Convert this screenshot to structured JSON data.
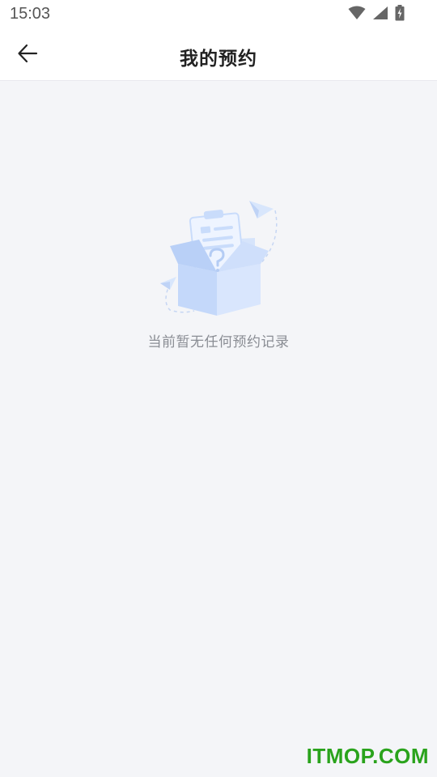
{
  "status_bar": {
    "time": "15:03",
    "icons": [
      "wifi-icon",
      "cellular-signal-icon",
      "battery-charging-icon"
    ]
  },
  "header": {
    "title": "我的预约",
    "back_icon": "arrow-left-icon"
  },
  "empty_state": {
    "illustration": "empty-box-with-clipboard-and-paper-planes",
    "message": "当前暂无任何预约记录"
  },
  "watermark": {
    "text": "ITMOP.COM",
    "color": "#2aa31c"
  },
  "colors": {
    "background": "#f4f5f8",
    "header_background": "#ffffff",
    "title_text": "#222222",
    "empty_text": "#8a8d94",
    "illustration_blue": "#c9dcfb"
  }
}
